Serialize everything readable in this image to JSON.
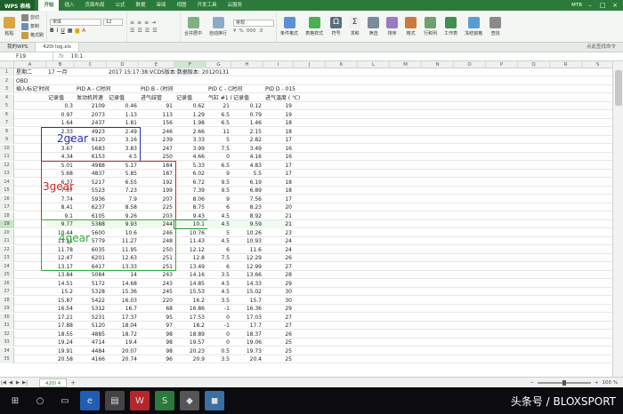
{
  "menubar": {
    "app_name": "WPS 表格",
    "menus": [
      "开始",
      "插入",
      "页面布局",
      "公式",
      "数据",
      "审阅",
      "视图",
      "开发工具",
      "云服务"
    ],
    "user": "MTB"
  },
  "ribbon": {
    "paste": "粘贴",
    "cut": "剪切",
    "copy": "复制",
    "format_painter": "格式刷",
    "font_name": "宋体",
    "font_size": "12",
    "number_format": "常规",
    "merge_center": "合并居中",
    "auto_wrap": "自动换行",
    "conditional_format": "条件格式",
    "table_style": "表格样式",
    "symbol": "符号",
    "sum": "求和",
    "filter": "筛选",
    "sort": "排序",
    "format": "格式",
    "row_col": "行和列",
    "worksheet": "工作表",
    "freeze": "冻结窗格",
    "find": "查找",
    "cmd_search": "点此查找命令"
  },
  "doc_tabs": [
    "我的WPS",
    "420i log.xls"
  ],
  "formula_bar": {
    "cell_ref": "F19",
    "fx_value": "10.1"
  },
  "columns": [
    "A",
    "B",
    "C",
    "D",
    "E",
    "F",
    "G",
    "H",
    "I",
    "J",
    "K",
    "L",
    "M",
    "N",
    "O",
    "P",
    "Q",
    "R",
    "S"
  ],
  "header_rows": [
    {
      "n": "1",
      "a": "星期二",
      "b": "17 一月",
      "d": "2017 15:17:38:VCDS版本:数据版本: 20120131"
    },
    {
      "n": "2",
      "a": "OBD"
    },
    {
      "n": "3",
      "a": "插入标记'时间",
      "c": "PID A - C时间",
      "e": "PID B - (时间",
      "g": "PID C - C时间",
      "i": "PID D - 015"
    },
    {
      "n": "4",
      "b": "记录值",
      "c": "发动机转速",
      "d": "记录值",
      "e": "进气歧管",
      "f": "记录值",
      "g": "气缸 #1 (",
      "h": "记录值",
      "i": "进气温度 ( ℃)"
    }
  ],
  "data_rows": [
    {
      "n": "5",
      "v": [
        "0.3",
        "2109",
        "0.46",
        "91",
        "0.62",
        "21",
        "0.12",
        "19"
      ]
    },
    {
      "n": "6",
      "v": [
        "0.97",
        "2073",
        "1.13",
        "113",
        "1.29",
        "6.5",
        "0.79",
        "19"
      ]
    },
    {
      "n": "7",
      "v": [
        "1.64",
        "2437",
        "1.81",
        "156",
        "1.98",
        "6.5",
        "1.46",
        "18"
      ]
    },
    {
      "n": "8",
      "v": [
        "2.33",
        "4923",
        "2.49",
        "246",
        "2.66",
        "11",
        "2.15",
        "18"
      ]
    },
    {
      "n": "9",
      "v": [
        "3",
        "6120",
        "3.16",
        "239",
        "3.33",
        "5",
        "2.82",
        "17"
      ]
    },
    {
      "n": "10",
      "v": [
        "3.67",
        "5683",
        "3.83",
        "247",
        "3.99",
        "7.5",
        "3.49",
        "16"
      ]
    },
    {
      "n": "11",
      "v": [
        "4.34",
        "6153",
        "4.5",
        "250",
        "4.66",
        "0",
        "4.16",
        "16"
      ]
    },
    {
      "n": "12",
      "v": [
        "5.01",
        "4988",
        "5.17",
        "184",
        "5.33",
        "6.5",
        "4.83",
        "17"
      ]
    },
    {
      "n": "13",
      "v": [
        "5.68",
        "4837",
        "5.85",
        "187",
        "6.02",
        "9",
        "5.5",
        "17"
      ]
    },
    {
      "n": "14",
      "v": [
        "6.37",
        "5217",
        "6.55",
        "192",
        "6.72",
        "9.5",
        "6.19",
        "18"
      ]
    },
    {
      "n": "15",
      "v": [
        "7.07",
        "5523",
        "7.23",
        "199",
        "7.39",
        "9.5",
        "6.89",
        "18"
      ]
    },
    {
      "n": "16",
      "v": [
        "7.74",
        "5936",
        "7.9",
        "207",
        "8.06",
        "9",
        "7.56",
        "17"
      ]
    },
    {
      "n": "17",
      "v": [
        "8.41",
        "6237",
        "8.58",
        "225",
        "8.75",
        "6",
        "8.23",
        "20"
      ]
    },
    {
      "n": "18",
      "v": [
        "9.1",
        "6105",
        "9.26",
        "203",
        "9.43",
        "4.5",
        "8.92",
        "21"
      ]
    },
    {
      "n": "19",
      "v": [
        "9.77",
        "5388",
        "9.93",
        "244",
        "10.1",
        "4.5",
        "9.59",
        "21"
      ]
    },
    {
      "n": "20",
      "v": [
        "10.44",
        "5600",
        "10.6",
        "246",
        "10.76",
        "5",
        "10.26",
        "23"
      ]
    },
    {
      "n": "21",
      "v": [
        "11.11",
        "5779",
        "11.27",
        "248",
        "11.43",
        "4.5",
        "10.93",
        "24"
      ]
    },
    {
      "n": "22",
      "v": [
        "11.78",
        "6035",
        "11.95",
        "250",
        "12.12",
        "6",
        "11.6",
        "24"
      ]
    },
    {
      "n": "23",
      "v": [
        "12.47",
        "6201",
        "12.63",
        "251",
        "12.8",
        "7.5",
        "12.29",
        "26"
      ]
    },
    {
      "n": "24",
      "v": [
        "13.17",
        "6417",
        "13.33",
        "251",
        "13.49",
        "6",
        "12.99",
        "27"
      ]
    },
    {
      "n": "25",
      "v": [
        "13.84",
        "5084",
        "14",
        "243",
        "14.16",
        "3.5",
        "13.66",
        "28"
      ]
    },
    {
      "n": "26",
      "v": [
        "14.51",
        "5172",
        "14.68",
        "243",
        "14.85",
        "4.5",
        "14.33",
        "29"
      ]
    },
    {
      "n": "27",
      "v": [
        "15.2",
        "5328",
        "15.36",
        "245",
        "15.53",
        "4.5",
        "15.02",
        "30"
      ]
    },
    {
      "n": "28",
      "v": [
        "15.87",
        "5422",
        "16.03",
        "220",
        "16.2",
        "3.5",
        "15.7",
        "30"
      ]
    },
    {
      "n": "29",
      "v": [
        "16.54",
        "5312",
        "16.7",
        "68",
        "16.86",
        "-1",
        "16.36",
        "29"
      ]
    },
    {
      "n": "30",
      "v": [
        "17.21",
        "5231",
        "17.37",
        "95",
        "17.53",
        "0",
        "17.03",
        "27"
      ]
    },
    {
      "n": "31",
      "v": [
        "17.88",
        "5120",
        "18.04",
        "97",
        "18.2",
        "-1",
        "17.7",
        "27"
      ]
    },
    {
      "n": "32",
      "v": [
        "18.55",
        "4885",
        "18.72",
        "98",
        "18.89",
        "0",
        "18.37",
        "26"
      ]
    },
    {
      "n": "33",
      "v": [
        "19.24",
        "4714",
        "19.4",
        "98",
        "19.57",
        "0",
        "19.06",
        "25"
      ]
    },
    {
      "n": "34",
      "v": [
        "19.91",
        "4484",
        "20.07",
        "98",
        "20.23",
        "0.5",
        "19.73",
        "25"
      ]
    },
    {
      "n": "35",
      "v": [
        "20.58",
        "4166",
        "20.74",
        "96",
        "20.9",
        "3.5",
        "20.4",
        "25"
      ]
    }
  ],
  "annotations": {
    "gear2": {
      "label": "2gear",
      "color": "#2b2fb8"
    },
    "gear3": {
      "label": "3gear",
      "color": "#d8232a"
    },
    "gear4": {
      "label": "4gear",
      "color": "#2fae3a"
    }
  },
  "sheet_tabs": [
    "420i 4"
  ],
  "zoom": "100 %",
  "watermark": "头条号 / BLOXSPORT"
}
